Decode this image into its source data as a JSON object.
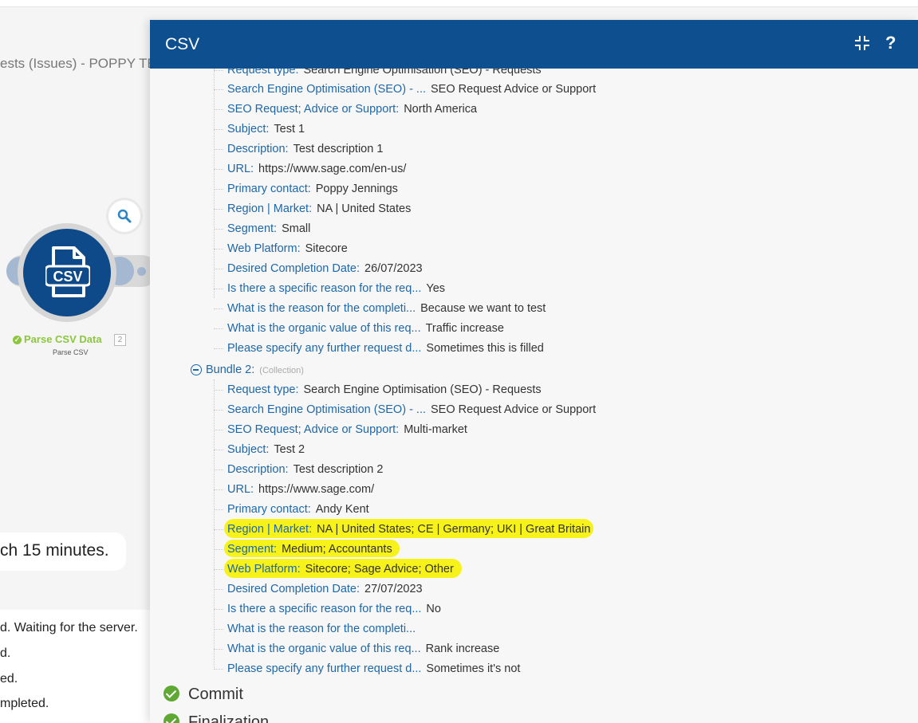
{
  "background": {
    "scenario_title": "ests (Issues) - POPPY TES",
    "module_name": "Parse CSV Data",
    "module_badge": "2",
    "module_subtitle": "Parse CSV",
    "module_icon_text": "CSV",
    "toast_text": "ch 15 minutes.",
    "log_lines": [
      "d. Waiting for the server.",
      "d.",
      "ed.",
      "mpleted."
    ]
  },
  "dialog": {
    "title": "CSV",
    "help_label": "?",
    "bundle1_rows": [
      {
        "label": "Request type:",
        "value": "Search Engine Optimisation (SEO) - Requests"
      },
      {
        "label": "Search Engine Optimisation (SEO) - ...",
        "value": "SEO Request Advice or Support"
      },
      {
        "label": "SEO Request; Advice or Support:",
        "value": "North America"
      },
      {
        "label": "Subject:",
        "value": "Test 1"
      },
      {
        "label": "Description:",
        "value": "Test description 1"
      },
      {
        "label": "URL:",
        "value": "https://www.sage.com/en-us/"
      },
      {
        "label": "Primary contact:",
        "value": "Poppy Jennings"
      },
      {
        "label": "Region | Market:",
        "value": "NA | United States"
      },
      {
        "label": "Segment:",
        "value": "Small"
      },
      {
        "label": "Web Platform:",
        "value": "Sitecore"
      },
      {
        "label": "Desired Completion Date:",
        "value": "26/07/2023"
      },
      {
        "label": "Is there a specific reason for the req...",
        "value": "Yes"
      },
      {
        "label": "What is the reason for the completi...",
        "value": "Because we want to test"
      },
      {
        "label": "What is the organic value of this req...",
        "value": "Traffic increase"
      },
      {
        "label": "Please specify any further request d...",
        "value": "Sometimes this is filled"
      }
    ],
    "bundle2": {
      "label": "Bundle 2:",
      "type": "(Collection)"
    },
    "bundle2_rows": [
      {
        "label": "Request type:",
        "value": "Search Engine Optimisation (SEO) - Requests"
      },
      {
        "label": "Search Engine Optimisation (SEO) - ...",
        "value": "SEO Request Advice or Support"
      },
      {
        "label": "SEO Request; Advice or Support:",
        "value": "Multi-market"
      },
      {
        "label": "Subject:",
        "value": "Test 2"
      },
      {
        "label": "Description:",
        "value": "Test description 2"
      },
      {
        "label": "URL:",
        "value": "https://www.sage.com/"
      },
      {
        "label": "Primary contact:",
        "value": "Andy Kent"
      },
      {
        "label": "Region | Market:",
        "value": "NA | United States; CE | Germany; UKI | Great Britain"
      },
      {
        "label": "Segment:",
        "value": "Medium; Accountants"
      },
      {
        "label": "Web Platform:",
        "value": "Sitecore; Sage Advice; Other"
      },
      {
        "label": "Desired Completion Date:",
        "value": "27/07/2023"
      },
      {
        "label": "Is there a specific reason for the req...",
        "value": "No"
      },
      {
        "label": "What is the reason for the completi...",
        "value": ""
      },
      {
        "label": "What is the organic value of this req...",
        "value": "Rank increase"
      },
      {
        "label": "Please specify any further request d...",
        "value": "Sometimes it's not"
      }
    ],
    "steps": [
      "Commit",
      "Finalization"
    ],
    "highlight_color": "#f6f21a",
    "header_color": "#0e4f8f",
    "label_color": "#1e67a8"
  }
}
